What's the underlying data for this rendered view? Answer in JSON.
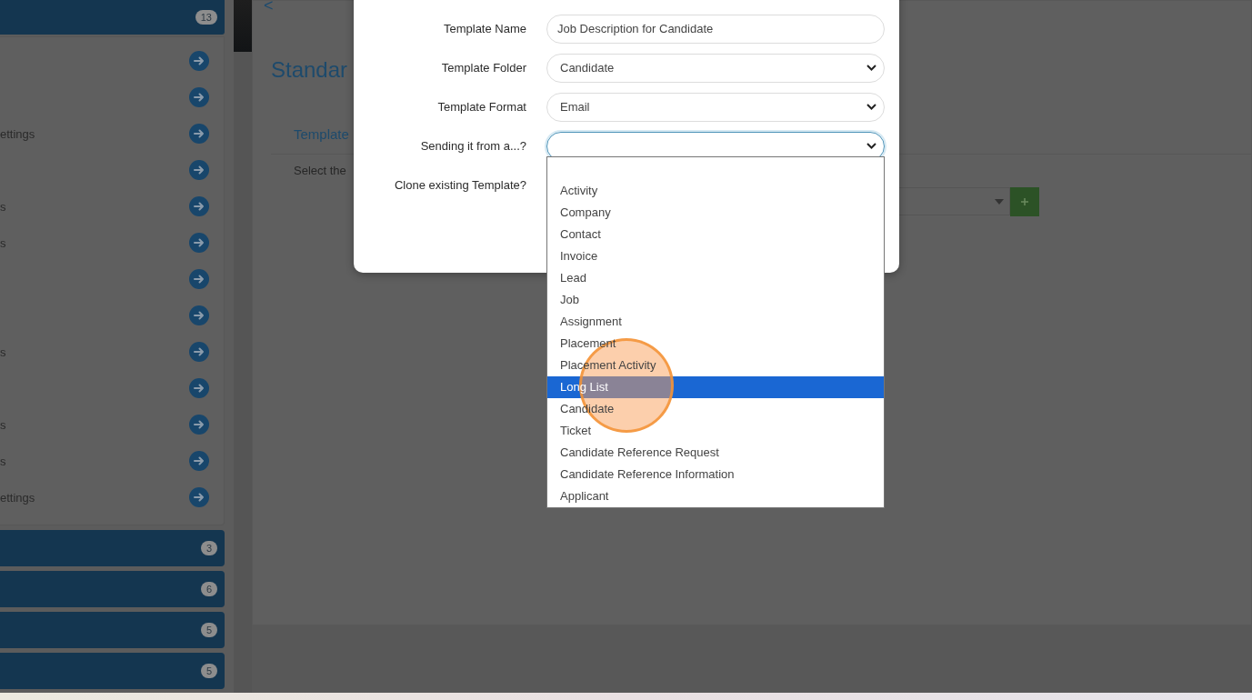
{
  "sidebar": {
    "header": {
      "badge": "13"
    },
    "items": [
      {
        "kind": "blank"
      },
      {
        "kind": "blank"
      },
      {
        "kind": "text",
        "label": "ettings"
      },
      {
        "kind": "blank"
      },
      {
        "kind": "text",
        "label": "s"
      },
      {
        "kind": "text",
        "label": "s"
      },
      {
        "kind": "blank"
      },
      {
        "kind": "blank"
      },
      {
        "kind": "text",
        "label": "s"
      },
      {
        "kind": "blank"
      },
      {
        "kind": "text",
        "label": "s"
      },
      {
        "kind": "text",
        "label": "s"
      },
      {
        "kind": "text",
        "label": "ettings"
      }
    ],
    "groups": [
      {
        "badge": "3"
      },
      {
        "badge": "6"
      },
      {
        "badge": "5"
      },
      {
        "badge": "5"
      }
    ]
  },
  "main": {
    "back": "<",
    "title": "Standar",
    "section": "Template",
    "hint": "Select the"
  },
  "modal": {
    "fields": [
      {
        "label": "Template Name",
        "kind": "text",
        "value": "Job Description for Candidate",
        "focused": false
      },
      {
        "label": "Template Folder",
        "kind": "select",
        "value": "Candidate",
        "focused": false
      },
      {
        "label": "Template Format",
        "kind": "select",
        "value": "Email",
        "focused": false
      },
      {
        "label": "Sending it from a...?",
        "kind": "select",
        "focused": true
      },
      {
        "label": "Clone existing Template?",
        "kind": "none"
      }
    ]
  },
  "dropdown": {
    "options": [
      {
        "label": "Activity",
        "selected": false
      },
      {
        "label": "Company",
        "selected": false
      },
      {
        "label": "Contact",
        "selected": false
      },
      {
        "label": "Invoice",
        "selected": false
      },
      {
        "label": "Lead",
        "selected": false
      },
      {
        "label": "Job",
        "selected": false
      },
      {
        "label": "Assignment",
        "selected": false
      },
      {
        "label": "Placement",
        "selected": false
      },
      {
        "label": "Placement Activity",
        "selected": false
      },
      {
        "label": "Long List",
        "selected": true
      },
      {
        "label": "Candidate",
        "selected": false
      },
      {
        "label": "Ticket",
        "selected": false
      },
      {
        "label": "Candidate Reference Request",
        "selected": false
      },
      {
        "label": "Candidate Reference Information",
        "selected": false
      },
      {
        "label": "Applicant",
        "selected": false
      }
    ]
  }
}
